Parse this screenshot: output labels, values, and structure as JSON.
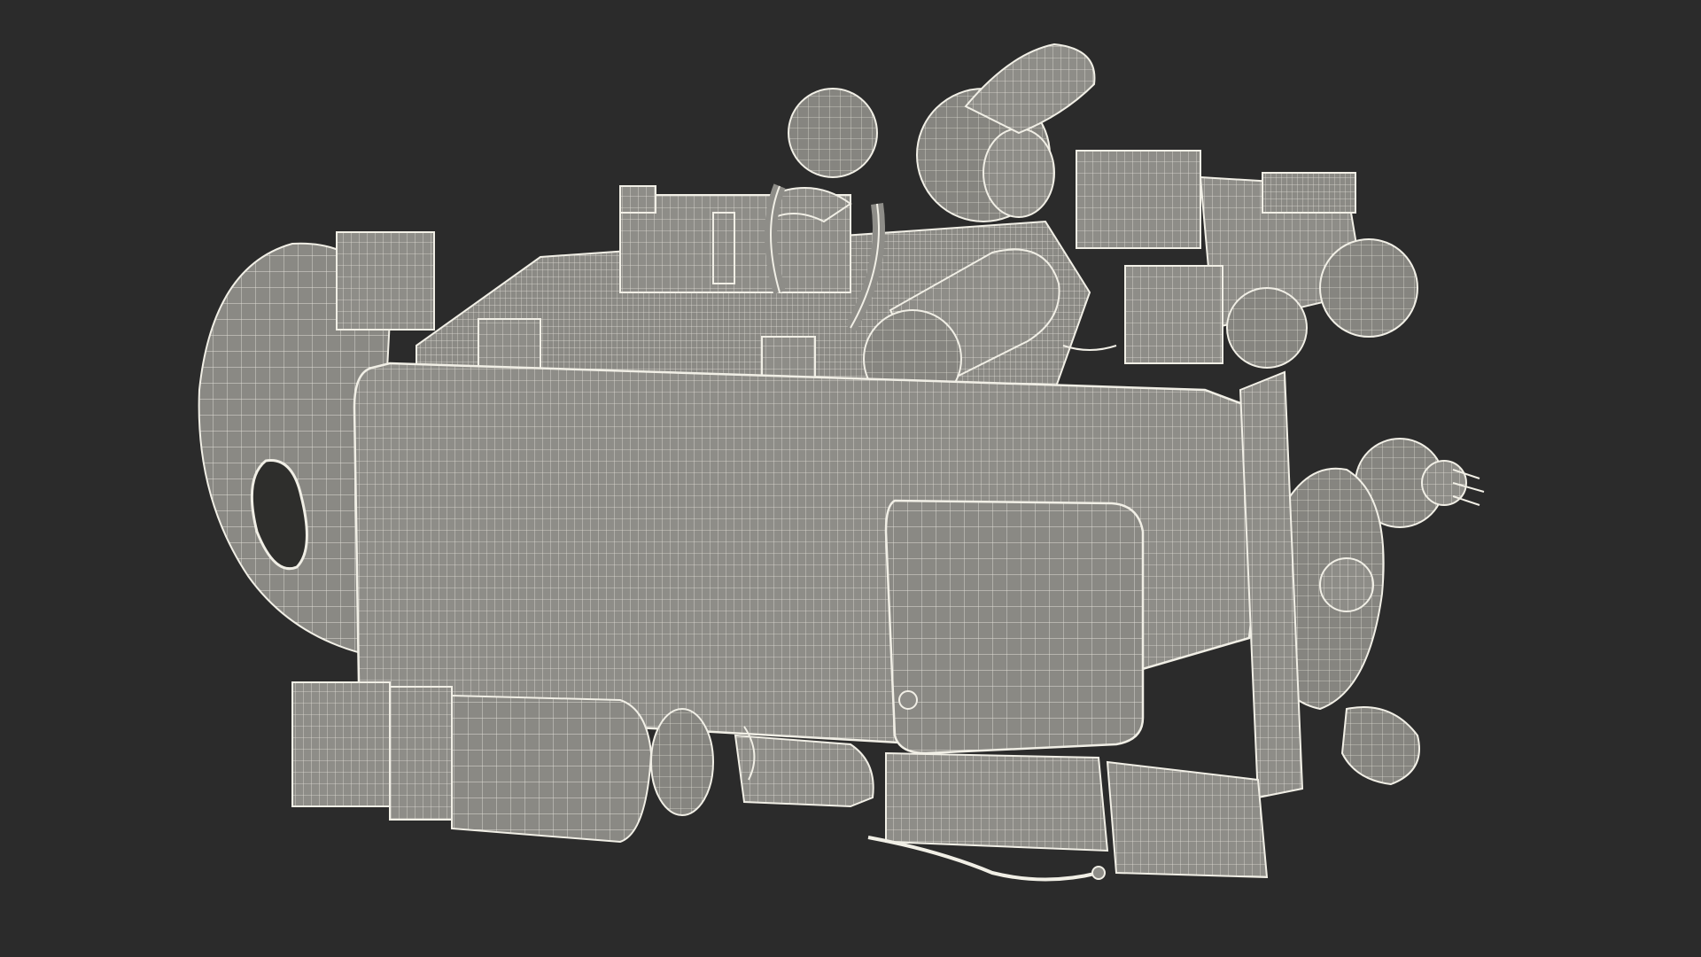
{
  "scene": {
    "background_color": "#2b2b2b",
    "model_fill_color": "#8e8d88",
    "model_shadow_color": "#6f6e6a",
    "wire_color": "#f1efe6",
    "subject": "engine-wireframe"
  }
}
